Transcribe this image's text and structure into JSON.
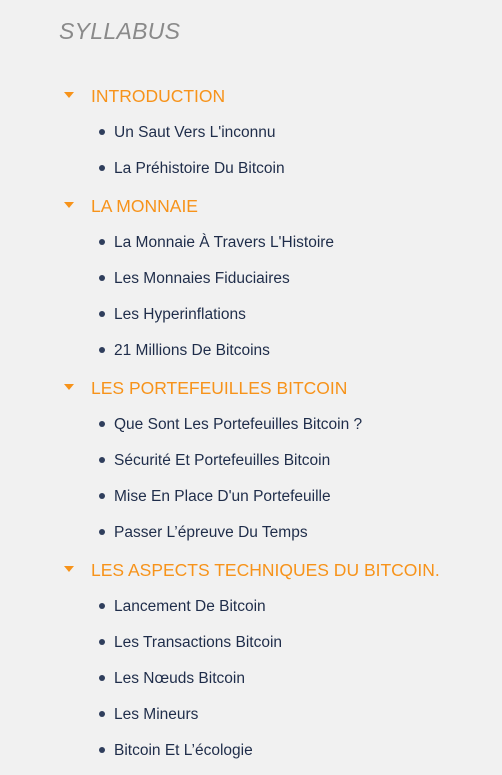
{
  "syllabus": {
    "title": "SYLLABUS",
    "accent_color": "#f7931a",
    "text_color": "#1f2d4a",
    "sections": [
      {
        "title": "INTRODUCTION",
        "icon": "caret-down-icon",
        "lessons": [
          "Un Saut Vers L'inconnu",
          "La Préhistoire Du Bitcoin"
        ]
      },
      {
        "title": "LA MONNAIE",
        "icon": "caret-down-icon",
        "lessons": [
          "La Monnaie À Travers L'Histoire",
          "Les Monnaies Fiduciaires",
          "Les Hyperinflations",
          "21 Millions De Bitcoins"
        ]
      },
      {
        "title": "LES PORTEFEUILLES BITCOIN",
        "icon": "caret-down-icon",
        "lessons": [
          "Que Sont Les Portefeuilles Bitcoin ?",
          "Sécurité Et Portefeuilles Bitcoin",
          "Mise En Place D'un Portefeuille",
          "Passer L’épreuve Du Temps"
        ]
      },
      {
        "title": "LES ASPECTS TECHNIQUES DU BITCOIN.",
        "icon": "caret-down-icon",
        "lessons": [
          "Lancement De Bitcoin",
          "Les Transactions Bitcoin",
          "Les Nœuds Bitcoin",
          "Les Mineurs",
          "Bitcoin Et L’écologie"
        ]
      }
    ]
  }
}
